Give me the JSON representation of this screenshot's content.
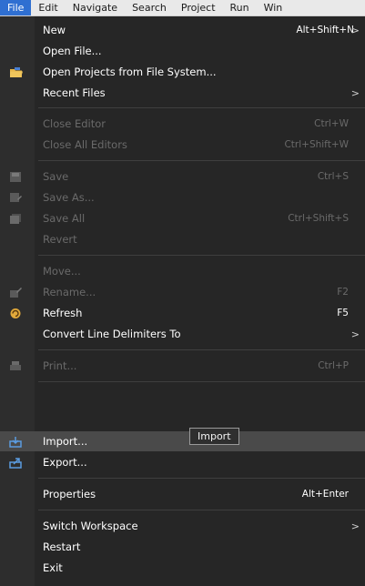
{
  "menubar": {
    "items": [
      {
        "label": "File",
        "active": true
      },
      {
        "label": "Edit"
      },
      {
        "label": "Navigate"
      },
      {
        "label": "Search"
      },
      {
        "label": "Project"
      },
      {
        "label": "Run"
      },
      {
        "label": "Win"
      }
    ]
  },
  "menu": {
    "new": {
      "label": "New",
      "accel": "Alt+Shift+N",
      "submenu": ">"
    },
    "open_file": {
      "label": "Open File..."
    },
    "open_projects": {
      "label": "Open Projects from File System..."
    },
    "recent_files": {
      "label": "Recent Files",
      "submenu": ">"
    },
    "close_editor": {
      "label": "Close Editor",
      "accel": "Ctrl+W"
    },
    "close_all_editors": {
      "label": "Close All Editors",
      "accel": "Ctrl+Shift+W"
    },
    "save": {
      "label": "Save",
      "accel": "Ctrl+S"
    },
    "save_as": {
      "label": "Save As..."
    },
    "save_all": {
      "label": "Save All",
      "accel": "Ctrl+Shift+S"
    },
    "revert": {
      "label": "Revert"
    },
    "move": {
      "label": "Move..."
    },
    "rename": {
      "label": "Rename...",
      "accel": "F2"
    },
    "refresh": {
      "label": "Refresh",
      "accel": "F5"
    },
    "convert_line_delimiters": {
      "label": "Convert Line Delimiters To",
      "submenu": ">"
    },
    "print": {
      "label": "Print...",
      "accel": "Ctrl+P"
    },
    "import": {
      "label": "Import..."
    },
    "export": {
      "label": "Export..."
    },
    "properties": {
      "label": "Properties",
      "accel": "Alt+Enter"
    },
    "switch_workspace": {
      "label": "Switch Workspace",
      "submenu": ">"
    },
    "restart": {
      "label": "Restart"
    },
    "exit": {
      "label": "Exit"
    }
  },
  "tooltip": {
    "text": "Import"
  },
  "colors": {
    "menu_bg": "#262626",
    "menubar_bg": "#e9e9e9",
    "active_menu": "#2f6fd1",
    "highlight": "#4a4a4a",
    "disabled_text": "#6a6a6a"
  }
}
